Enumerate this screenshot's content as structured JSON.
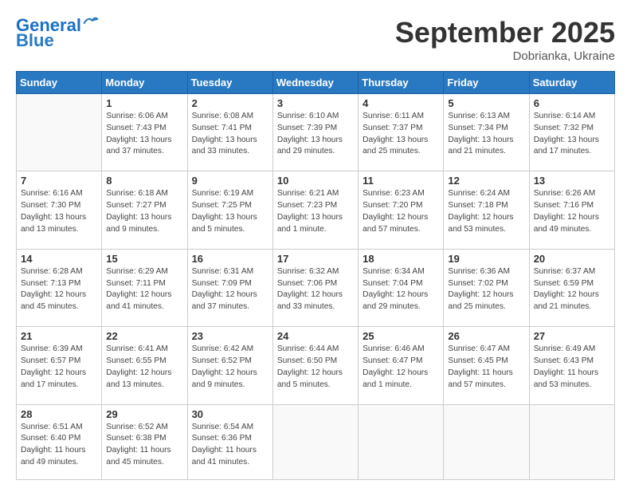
{
  "header": {
    "logo_line1": "General",
    "logo_line2": "Blue",
    "month": "September 2025",
    "location": "Dobrianka, Ukraine"
  },
  "days_of_week": [
    "Sunday",
    "Monday",
    "Tuesday",
    "Wednesday",
    "Thursday",
    "Friday",
    "Saturday"
  ],
  "weeks": [
    [
      {
        "day": "",
        "detail": ""
      },
      {
        "day": "1",
        "detail": "Sunrise: 6:06 AM\nSunset: 7:43 PM\nDaylight: 13 hours\nand 37 minutes."
      },
      {
        "day": "2",
        "detail": "Sunrise: 6:08 AM\nSunset: 7:41 PM\nDaylight: 13 hours\nand 33 minutes."
      },
      {
        "day": "3",
        "detail": "Sunrise: 6:10 AM\nSunset: 7:39 PM\nDaylight: 13 hours\nand 29 minutes."
      },
      {
        "day": "4",
        "detail": "Sunrise: 6:11 AM\nSunset: 7:37 PM\nDaylight: 13 hours\nand 25 minutes."
      },
      {
        "day": "5",
        "detail": "Sunrise: 6:13 AM\nSunset: 7:34 PM\nDaylight: 13 hours\nand 21 minutes."
      },
      {
        "day": "6",
        "detail": "Sunrise: 6:14 AM\nSunset: 7:32 PM\nDaylight: 13 hours\nand 17 minutes."
      }
    ],
    [
      {
        "day": "7",
        "detail": "Sunrise: 6:16 AM\nSunset: 7:30 PM\nDaylight: 13 hours\nand 13 minutes."
      },
      {
        "day": "8",
        "detail": "Sunrise: 6:18 AM\nSunset: 7:27 PM\nDaylight: 13 hours\nand 9 minutes."
      },
      {
        "day": "9",
        "detail": "Sunrise: 6:19 AM\nSunset: 7:25 PM\nDaylight: 13 hours\nand 5 minutes."
      },
      {
        "day": "10",
        "detail": "Sunrise: 6:21 AM\nSunset: 7:23 PM\nDaylight: 13 hours\nand 1 minute."
      },
      {
        "day": "11",
        "detail": "Sunrise: 6:23 AM\nSunset: 7:20 PM\nDaylight: 12 hours\nand 57 minutes."
      },
      {
        "day": "12",
        "detail": "Sunrise: 6:24 AM\nSunset: 7:18 PM\nDaylight: 12 hours\nand 53 minutes."
      },
      {
        "day": "13",
        "detail": "Sunrise: 6:26 AM\nSunset: 7:16 PM\nDaylight: 12 hours\nand 49 minutes."
      }
    ],
    [
      {
        "day": "14",
        "detail": "Sunrise: 6:28 AM\nSunset: 7:13 PM\nDaylight: 12 hours\nand 45 minutes."
      },
      {
        "day": "15",
        "detail": "Sunrise: 6:29 AM\nSunset: 7:11 PM\nDaylight: 12 hours\nand 41 minutes."
      },
      {
        "day": "16",
        "detail": "Sunrise: 6:31 AM\nSunset: 7:09 PM\nDaylight: 12 hours\nand 37 minutes."
      },
      {
        "day": "17",
        "detail": "Sunrise: 6:32 AM\nSunset: 7:06 PM\nDaylight: 12 hours\nand 33 minutes."
      },
      {
        "day": "18",
        "detail": "Sunrise: 6:34 AM\nSunset: 7:04 PM\nDaylight: 12 hours\nand 29 minutes."
      },
      {
        "day": "19",
        "detail": "Sunrise: 6:36 AM\nSunset: 7:02 PM\nDaylight: 12 hours\nand 25 minutes."
      },
      {
        "day": "20",
        "detail": "Sunrise: 6:37 AM\nSunset: 6:59 PM\nDaylight: 12 hours\nand 21 minutes."
      }
    ],
    [
      {
        "day": "21",
        "detail": "Sunrise: 6:39 AM\nSunset: 6:57 PM\nDaylight: 12 hours\nand 17 minutes."
      },
      {
        "day": "22",
        "detail": "Sunrise: 6:41 AM\nSunset: 6:55 PM\nDaylight: 12 hours\nand 13 minutes."
      },
      {
        "day": "23",
        "detail": "Sunrise: 6:42 AM\nSunset: 6:52 PM\nDaylight: 12 hours\nand 9 minutes."
      },
      {
        "day": "24",
        "detail": "Sunrise: 6:44 AM\nSunset: 6:50 PM\nDaylight: 12 hours\nand 5 minutes."
      },
      {
        "day": "25",
        "detail": "Sunrise: 6:46 AM\nSunset: 6:47 PM\nDaylight: 12 hours\nand 1 minute."
      },
      {
        "day": "26",
        "detail": "Sunrise: 6:47 AM\nSunset: 6:45 PM\nDaylight: 11 hours\nand 57 minutes."
      },
      {
        "day": "27",
        "detail": "Sunrise: 6:49 AM\nSunset: 6:43 PM\nDaylight: 11 hours\nand 53 minutes."
      }
    ],
    [
      {
        "day": "28",
        "detail": "Sunrise: 6:51 AM\nSunset: 6:40 PM\nDaylight: 11 hours\nand 49 minutes."
      },
      {
        "day": "29",
        "detail": "Sunrise: 6:52 AM\nSunset: 6:38 PM\nDaylight: 11 hours\nand 45 minutes."
      },
      {
        "day": "30",
        "detail": "Sunrise: 6:54 AM\nSunset: 6:36 PM\nDaylight: 11 hours\nand 41 minutes."
      },
      {
        "day": "",
        "detail": ""
      },
      {
        "day": "",
        "detail": ""
      },
      {
        "day": "",
        "detail": ""
      },
      {
        "day": "",
        "detail": ""
      }
    ]
  ]
}
